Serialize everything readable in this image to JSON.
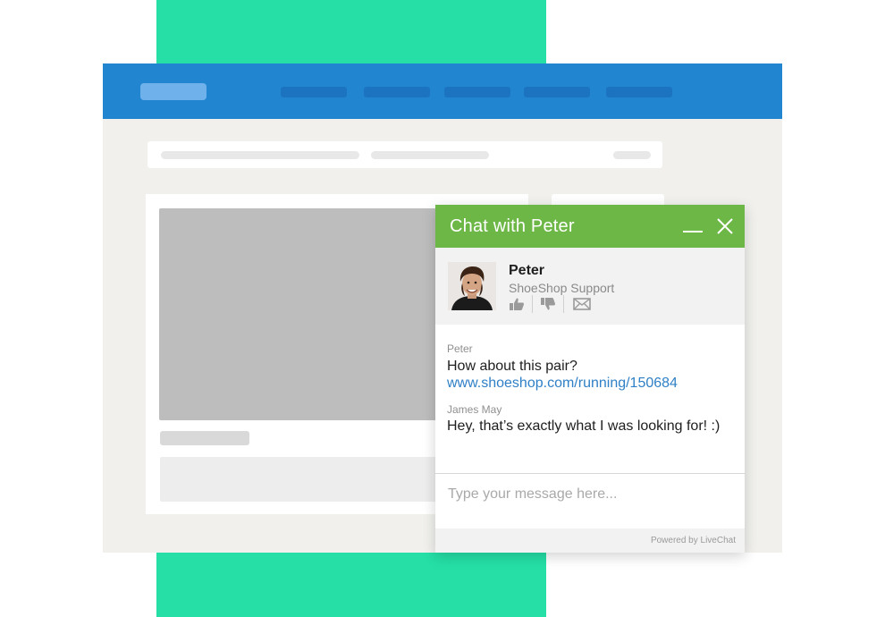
{
  "colors": {
    "accent_green": "#25dfa6",
    "topbar_blue": "#2185d0",
    "chat_header_green": "#6db747",
    "link_blue": "#2f80c6"
  },
  "chat": {
    "title": "Chat with Peter",
    "agent": {
      "name": "Peter",
      "team": "ShoeShop Support",
      "avatar_icon": "agent-photo"
    },
    "icons": [
      "minimize-icon",
      "close-icon",
      "thumbs-up-icon",
      "thumbs-down-icon",
      "envelope-icon"
    ],
    "messages": [
      {
        "author": "Peter",
        "text": "How about this pair?",
        "link": "www.shoeshop.com/running/150684"
      },
      {
        "author": "James May",
        "text": "Hey, that’s exactly what I was looking for! :)"
      }
    ],
    "input_placeholder": "Type your message here...",
    "powered_by": "Powered by LiveChat"
  }
}
